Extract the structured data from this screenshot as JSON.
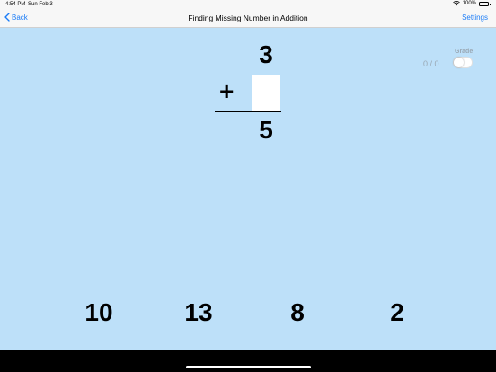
{
  "status_bar": {
    "time": "4:54 PM",
    "date": "Sun Feb 3",
    "dots": "....",
    "battery_text": "100%"
  },
  "nav": {
    "back_label": "Back",
    "title": "Finding Missing Number in Addition",
    "settings_label": "Settings",
    "accent_color": "#1a7cf7"
  },
  "problem": {
    "top_number": "3",
    "operator": "+",
    "result": "5"
  },
  "grade": {
    "score": "0 / 0",
    "label": "Grade",
    "toggle_on": false
  },
  "choices": [
    "10",
    "13",
    "8",
    "2"
  ],
  "colors": {
    "background": "#bde0f9",
    "bar": "#f7f7f7"
  }
}
